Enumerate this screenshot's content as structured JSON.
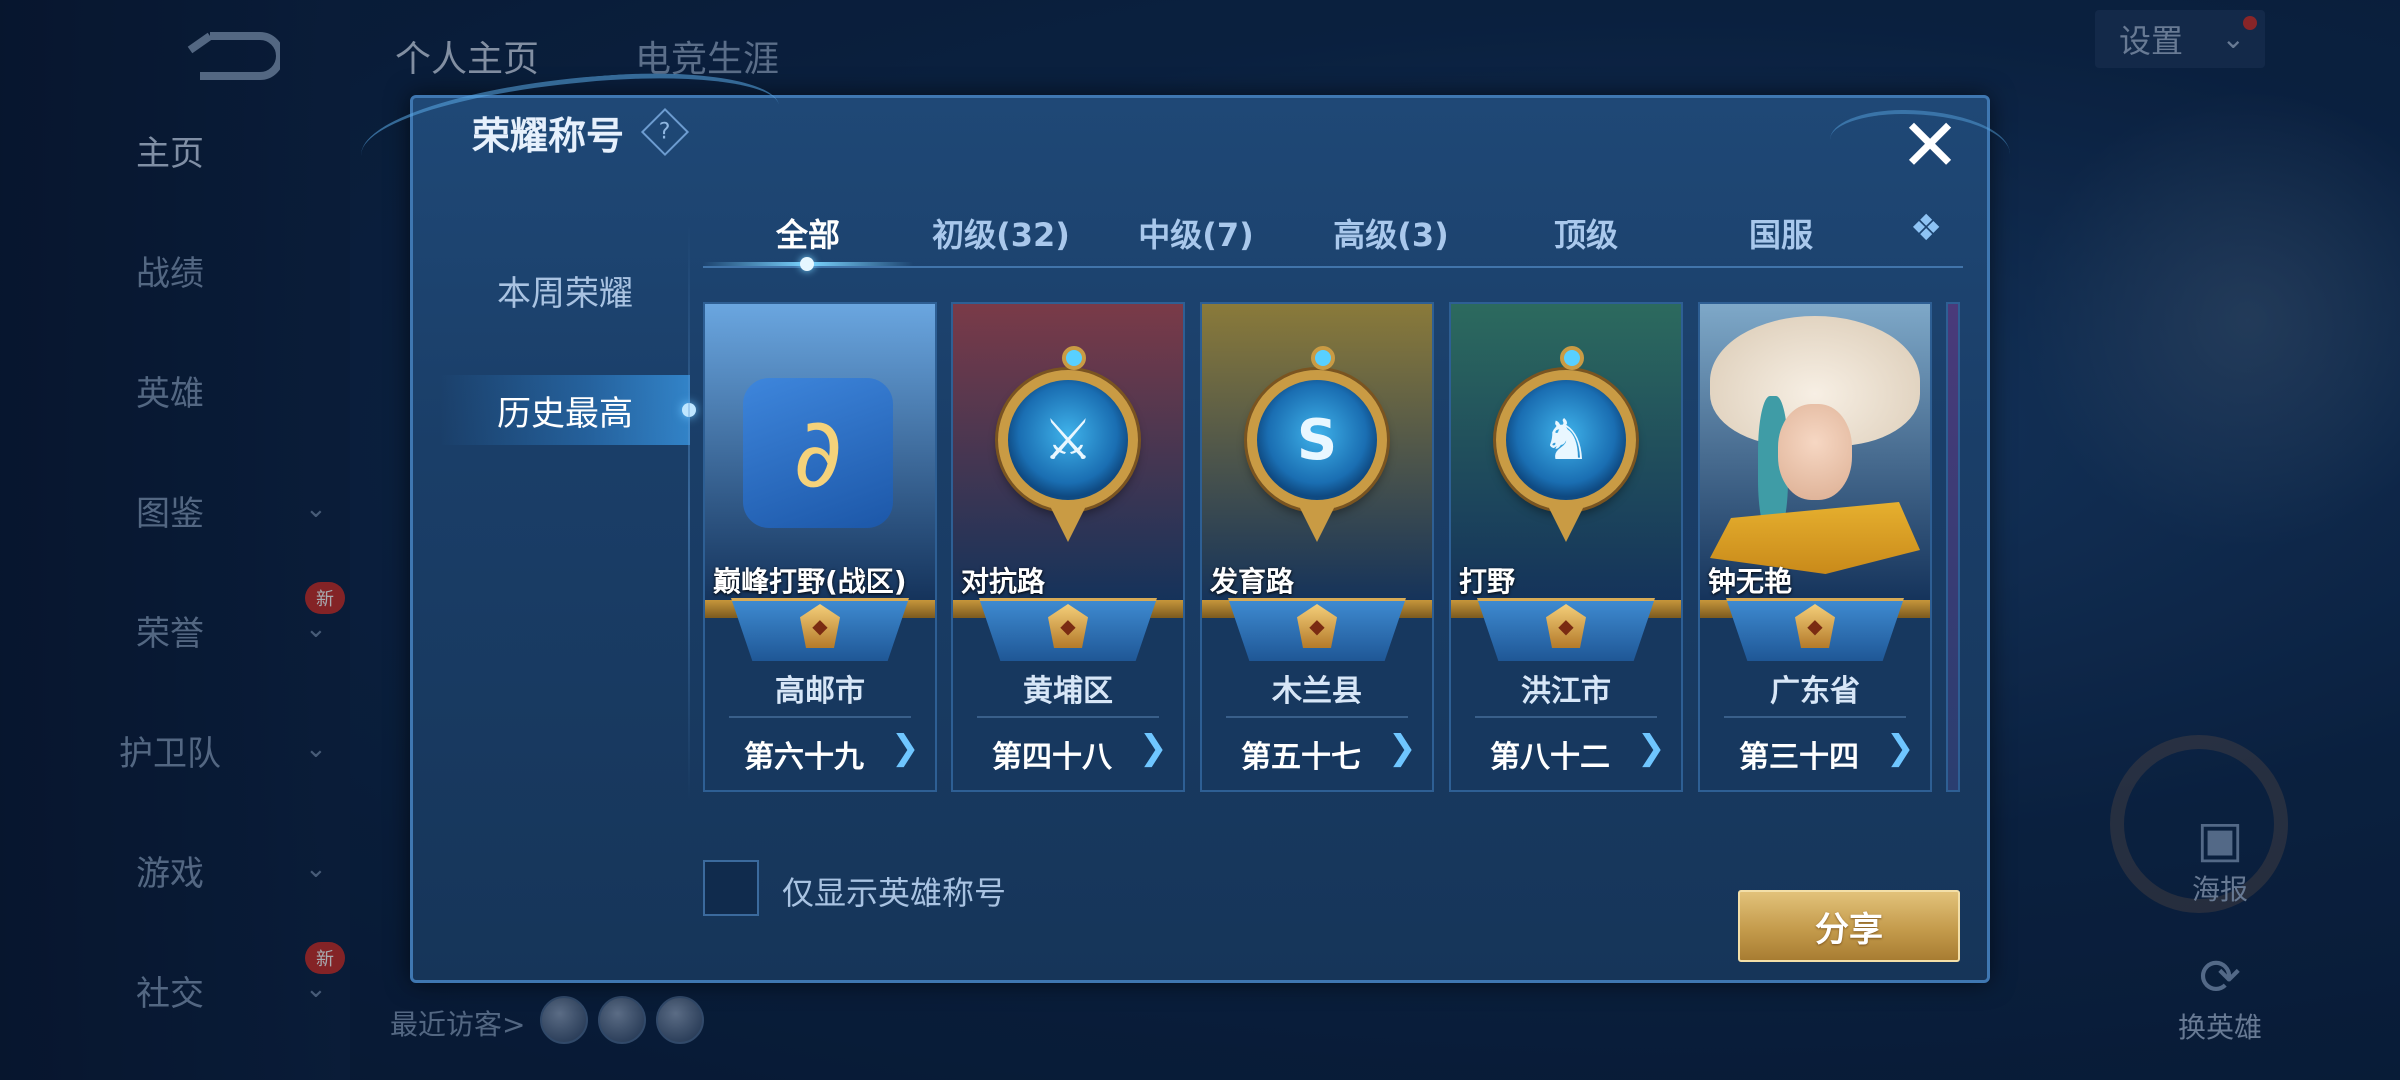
{
  "nav": {
    "items": [
      {
        "label": "主页",
        "chevron": false,
        "badge": ""
      },
      {
        "label": "战绩",
        "chevron": false,
        "badge": ""
      },
      {
        "label": "英雄",
        "chevron": false,
        "badge": ""
      },
      {
        "label": "图鉴",
        "chevron": true,
        "badge": ""
      },
      {
        "label": "荣誉",
        "chevron": true,
        "badge": "新"
      },
      {
        "label": "护卫队",
        "chevron": true,
        "badge": ""
      },
      {
        "label": "游戏",
        "chevron": true,
        "badge": ""
      },
      {
        "label": "社交",
        "chevron": true,
        "badge": "新"
      }
    ]
  },
  "top_tabs": [
    "个人主页",
    "电竞生涯"
  ],
  "settings": {
    "label": "设置"
  },
  "right_buttons": {
    "poster": "海报",
    "switch_hero": "换英雄"
  },
  "recent_visitors": {
    "label": "最近访客>"
  },
  "dialog": {
    "title": "荣耀称号",
    "help_icon": "?",
    "close_icon": "✕",
    "side_tabs": [
      "本周荣耀",
      "历史最高"
    ],
    "active_side_tab": 1,
    "category_tabs": [
      "全部",
      "初级(32)",
      "中级(7)",
      "高级(3)",
      "顶级",
      "国服"
    ],
    "active_category": 0,
    "more_icon": "❖",
    "cards": [
      {
        "name": "巅峰打野(战区)",
        "region": "高邮市",
        "rank": "第六十九",
        "art": "dragon-logo",
        "theme": "#6aa6e0"
      },
      {
        "name": "对抗路",
        "region": "黄埔区",
        "rank": "第四十八",
        "art": "sword-emblem",
        "theme": "#7a3a48"
      },
      {
        "name": "发育路",
        "region": "木兰县",
        "rank": "第五十七",
        "art": "shield-emblem",
        "theme": "#8a7a3a"
      },
      {
        "name": "打野",
        "region": "洪江市",
        "rank": "第八十二",
        "art": "dragon-emblem",
        "theme": "#2c6a5e"
      },
      {
        "name": "钟无艳",
        "region": "广东省",
        "rank": "第三十四",
        "art": "hero-portrait",
        "theme": "#7ea8c8"
      }
    ],
    "checkbox": {
      "label": "仅显示英雄称号",
      "checked": false
    },
    "share_button": "分享"
  }
}
